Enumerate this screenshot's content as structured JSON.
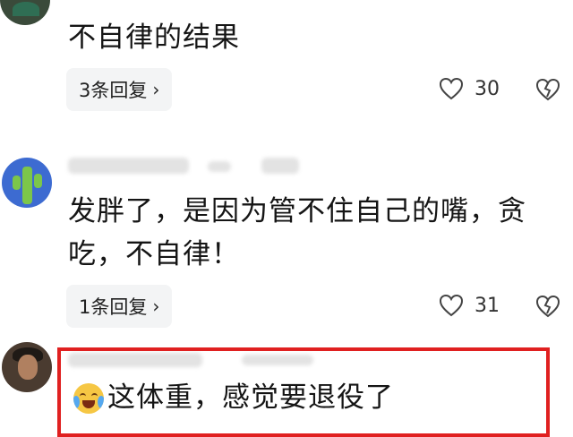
{
  "comments": [
    {
      "text": "不自律的结果",
      "replies_label": "3条回复",
      "likes": "30"
    },
    {
      "lines": [
        "发胖了，是因为管不住自己的嘴，贪",
        "吃，不自律！"
      ],
      "replies_label": "1条回复",
      "likes": "31"
    },
    {
      "text": "这体重，感觉要退役了"
    }
  ],
  "icons": {
    "reply_chevron": "chevron-right-icon",
    "like": "heart-outline-icon",
    "dislike": "broken-heart-icon",
    "emoji": "laughing-tears-emoji-icon"
  },
  "colors": {
    "highlight_border": "#e02020",
    "reply_button_bg": "#f3f4f5"
  }
}
